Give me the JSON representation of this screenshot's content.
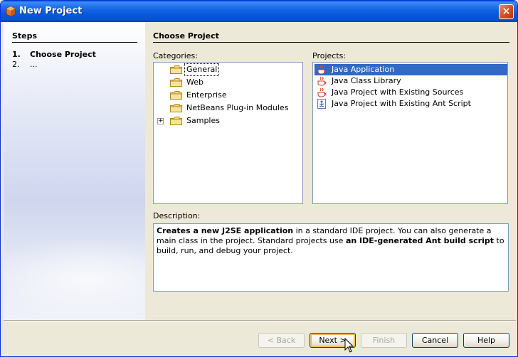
{
  "window": {
    "title": "New Project",
    "close_glyph": "×"
  },
  "steps": {
    "heading": "Steps",
    "items": [
      {
        "num": "1.",
        "label": "Choose Project"
      },
      {
        "num": "2.",
        "label": "..."
      }
    ]
  },
  "main": {
    "heading": "Choose Project",
    "categories_label": "Categories:",
    "categories": [
      {
        "label": "General",
        "selected": true,
        "icon": "folder-icon"
      },
      {
        "label": "Web",
        "icon": "folder-icon"
      },
      {
        "label": "Enterprise",
        "icon": "folder-icon"
      },
      {
        "label": "NetBeans Plug-in Modules",
        "icon": "folder-icon"
      },
      {
        "label": "Samples",
        "expandable": true,
        "expander_glyph": "+",
        "icon": "folder-icon"
      }
    ],
    "projects_label": "Projects:",
    "projects": [
      {
        "label": "Java Application",
        "selected": true,
        "icon": "java-cup-icon"
      },
      {
        "label": "Java Class Library",
        "icon": "java-cup-icon"
      },
      {
        "label": "Java Project with Existing Sources",
        "icon": "java-cup-icon"
      },
      {
        "label": "Java Project with Existing Ant Script",
        "icon": "ant-script-icon"
      }
    ],
    "description_label": "Description:",
    "description": {
      "bold1": "Creates a new J2SE application",
      "text1": " in a standard IDE project. You can also generate a main class in the project. Standard projects use ",
      "bold2": "an IDE-generated Ant build script",
      "text2": " to build, run, and debug your project."
    }
  },
  "buttons": {
    "back": "< Back",
    "next": "Next >",
    "finish": "Finish",
    "cancel": "Cancel",
    "help": "Help"
  },
  "colors": {
    "selection": "#316ac5",
    "titlebar": "#0a52d0",
    "dialog_bg": "#ece9d8"
  }
}
